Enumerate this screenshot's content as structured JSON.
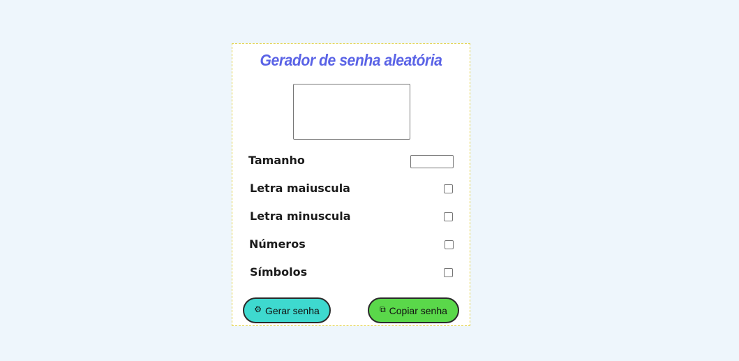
{
  "title": "Gerador de senha aleatória",
  "password": {
    "value": ""
  },
  "options": {
    "length_label": "Tamanho",
    "length_value": "",
    "uppercase_label": "Letra maiuscula",
    "uppercase_checked": false,
    "lowercase_label": "Letra minuscula",
    "lowercase_checked": false,
    "numbers_label": "Números",
    "numbers_checked": false,
    "symbols_label": "Símbolos",
    "symbols_checked": false
  },
  "buttons": {
    "generate_icon": "⚙",
    "generate_label": "Gerar senha",
    "copy_icon": "⧉",
    "copy_label": "Copiar senha"
  },
  "colors": {
    "title": "#5a63e6",
    "generate_button": "#3ed9cf",
    "copy_button": "#5ad84a",
    "background": "#eef6fc"
  }
}
